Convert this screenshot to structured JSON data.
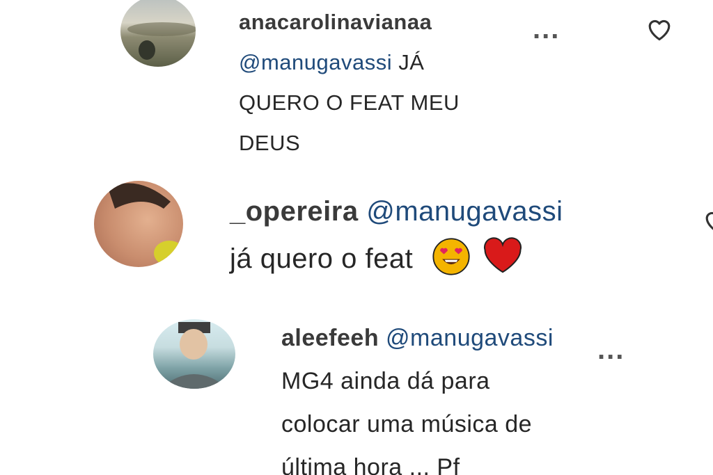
{
  "colors": {
    "text": "#262626",
    "mention": "#1f4a7a",
    "username": "#3a3a3a",
    "emoji_heart": "#d91a1a",
    "emoji_face": "#f4b400"
  },
  "comments": [
    {
      "username": "anacarolinavianaa",
      "mention": "@manugavassi",
      "text_line1_rest": " JÁ",
      "text_line2": "QUERO O FEAT MEU",
      "text_line3": "DEUS"
    },
    {
      "username": "_opereira",
      "mention": "@manugavassi",
      "text": "já quero o feat",
      "emojis": [
        "heart-eyes-emoji",
        "red-heart-emoji"
      ]
    },
    {
      "username": "aleefeeh",
      "mention": "@manugavassi",
      "text_line1": "MG4 ainda dá para",
      "text_line2": "colocar uma música de",
      "text_line3": "última hora ... Pf"
    }
  ],
  "icons": {
    "more": "more-options-icon",
    "like": "heart-outline-icon"
  },
  "more_label": "..."
}
